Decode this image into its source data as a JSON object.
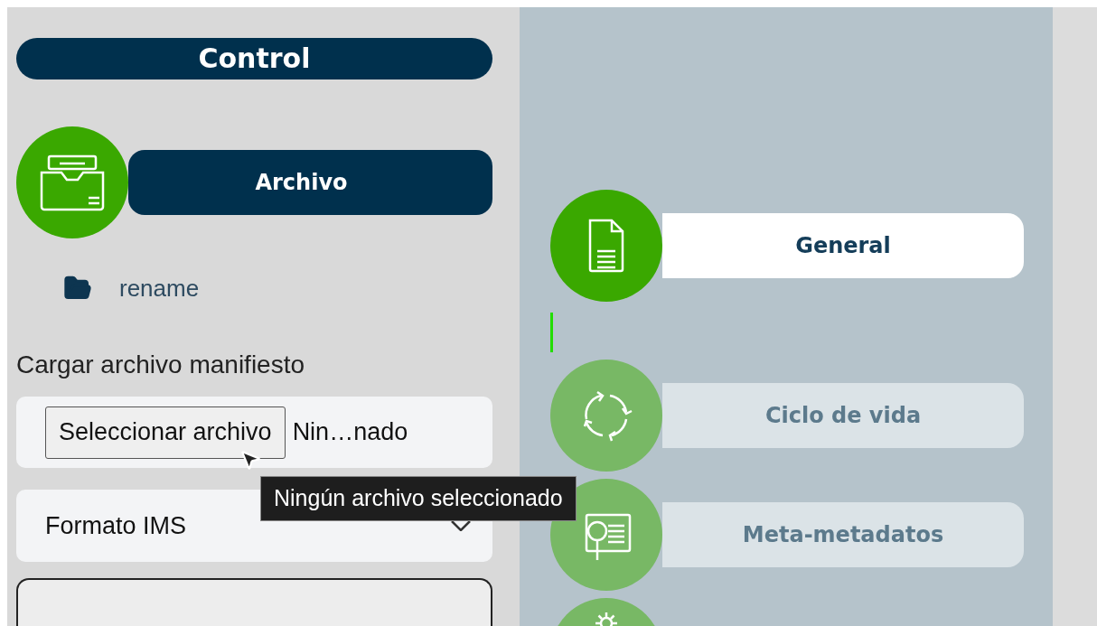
{
  "control": {
    "title": "Control"
  },
  "archivo": {
    "label": "Archivo"
  },
  "file_entry": {
    "name": "rename"
  },
  "upload": {
    "label": "Cargar archivo manifiesto",
    "button": "Seleccionar archivo",
    "status": "Nin…nado",
    "tooltip": "Ningún archivo seleccionado"
  },
  "format": {
    "value": "Formato IMS"
  },
  "sections": [
    {
      "kind": "general",
      "label": "General",
      "selected": true
    },
    {
      "kind": "lifecycle",
      "label": "Ciclo de vida",
      "selected": false
    },
    {
      "kind": "meta",
      "label": "Meta-metadatos",
      "selected": false
    },
    {
      "kind": "technical",
      "selected": false
    }
  ]
}
